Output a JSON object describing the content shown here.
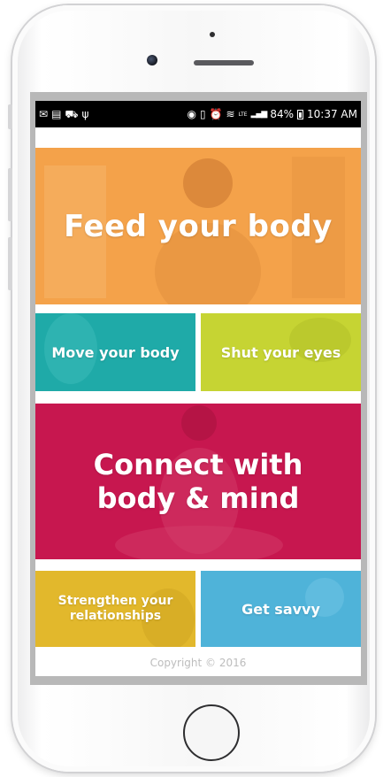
{
  "statusbar": {
    "left_icons": [
      "gmail-icon",
      "card-icon",
      "car-icon",
      "usb-icon"
    ],
    "right_icons": [
      "nfc-icon",
      "vibrate-icon",
      "alarm-icon",
      "wifi-icon",
      "signal-icon"
    ],
    "network_label": "LTE",
    "battery": "84%",
    "time": "10:37 AM"
  },
  "tiles": {
    "feed": "Feed your body",
    "move": "Move your body",
    "shut": "Shut your eyes",
    "connect_line1": "Connect with",
    "connect_line2": "body & mind",
    "strengthen_line1": "Strengthen your",
    "strengthen_line2": "relationships",
    "savvy": "Get savvy"
  },
  "footer": {
    "copyright": "Copyright © 2016"
  },
  "colors": {
    "feed": "#f4a24a",
    "move": "#1faaa8",
    "shut": "#c6d433",
    "connect": "#c7174f",
    "strengthen": "#e2b82c",
    "savvy": "#4fb3d9"
  }
}
